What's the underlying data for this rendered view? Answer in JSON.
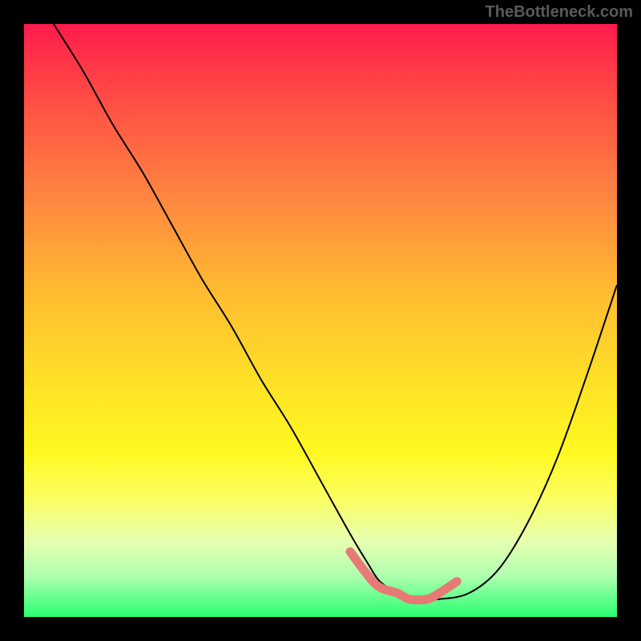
{
  "watermark": "TheBottleneck.com",
  "chart_data": {
    "type": "line",
    "title": "",
    "xlabel": "",
    "ylabel": "",
    "xlim": [
      0,
      100
    ],
    "ylim": [
      0,
      100
    ],
    "grid": false,
    "series": [
      {
        "name": "bottleneck-curve",
        "color": "#000000",
        "x": [
          5,
          10,
          15,
          20,
          25,
          30,
          35,
          40,
          45,
          50,
          55,
          58,
          60,
          63,
          65,
          68,
          70,
          75,
          80,
          85,
          90,
          95,
          100
        ],
        "values": [
          100,
          92,
          83,
          75,
          66,
          57,
          49,
          40,
          32,
          23,
          14,
          9,
          6,
          4,
          3,
          3,
          3,
          4,
          8,
          16,
          27,
          41,
          56
        ]
      },
      {
        "name": "highlight-band",
        "color": "#e77a74",
        "x": [
          55,
          58,
          60,
          63,
          65,
          68,
          70,
          73
        ],
        "values": [
          11,
          7,
          5,
          4,
          3,
          3,
          4,
          6
        ]
      }
    ],
    "gradient_stops": [
      {
        "pos": 0,
        "color": "#ff1a4d"
      },
      {
        "pos": 15,
        "color": "#ff5544"
      },
      {
        "pos": 45,
        "color": "#ffbb30"
      },
      {
        "pos": 72,
        "color": "#fff820"
      },
      {
        "pos": 93,
        "color": "#b0ffb0"
      },
      {
        "pos": 100,
        "color": "#28ff70"
      }
    ]
  }
}
